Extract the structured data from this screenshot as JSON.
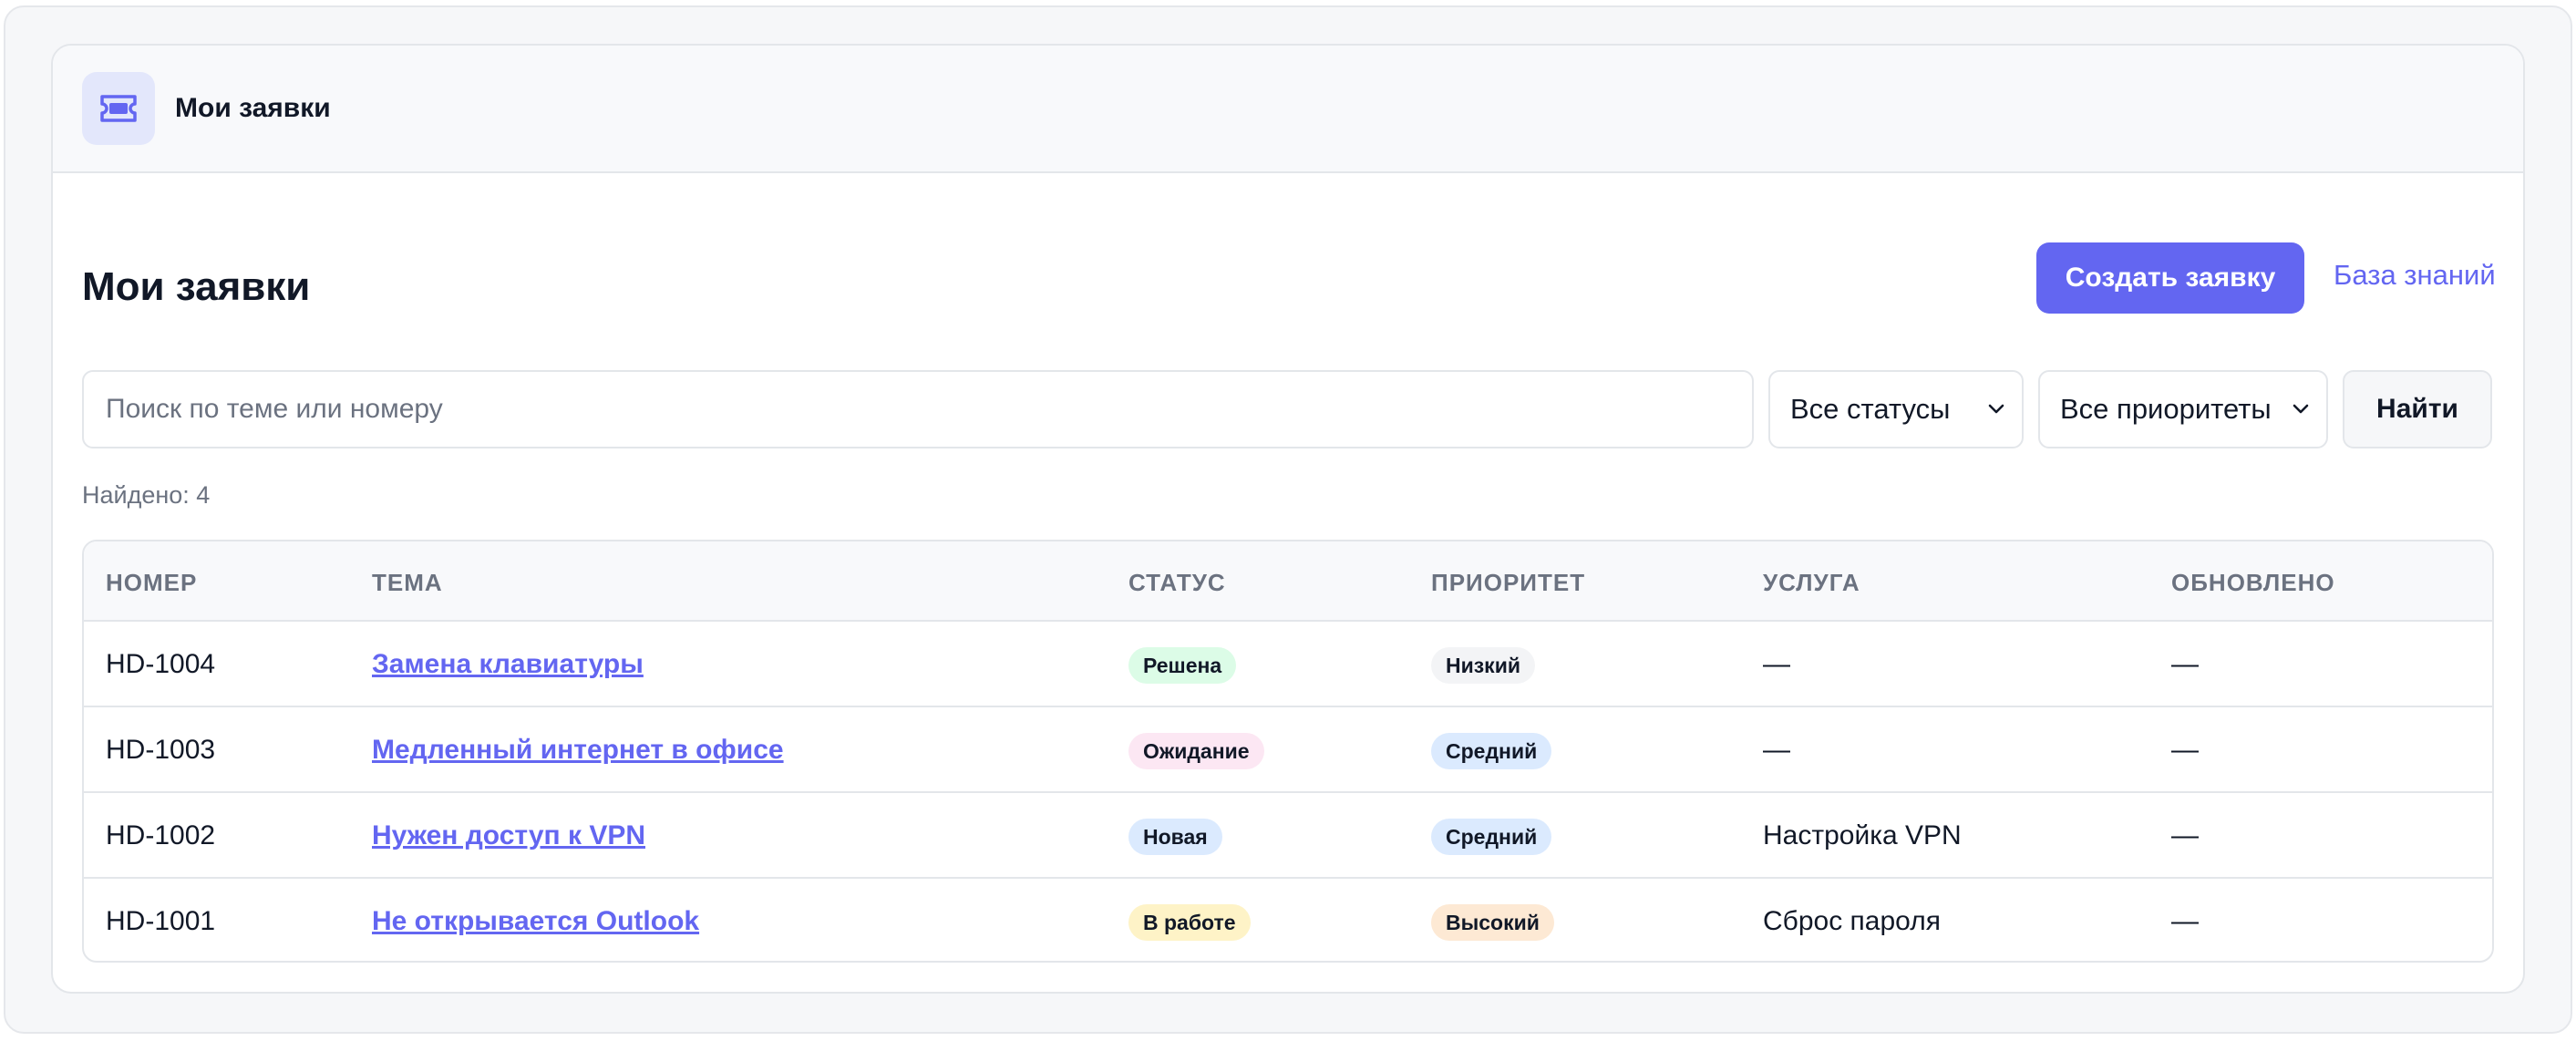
{
  "header": {
    "title": "Мои заявки",
    "icon": "ticket-icon",
    "accent": "#6366f1"
  },
  "main": {
    "title": "Мои заявки",
    "create_button": "Создать заявку",
    "kb_link": "База знаний"
  },
  "filters": {
    "search_placeholder": "Поиск по теме или номеру",
    "search_value": "",
    "status_selected": "Все статусы",
    "priority_selected": "Все приоритеты",
    "find_button": "Найти",
    "found_text": "Найдено: 4"
  },
  "table": {
    "columns": [
      "НОМЕР",
      "ТЕМА",
      "СТАТУС",
      "ПРИОРИТЕТ",
      "УСЛУГА",
      "ОБНОВЛЕНО"
    ],
    "rows": [
      {
        "number": "HD-1004",
        "topic": "Замена клавиатуры",
        "status": "Решена",
        "priority": "Низкий",
        "service": "—",
        "updated": "—"
      },
      {
        "number": "HD-1003",
        "topic": "Медленный интернет в офисе",
        "status": "Ожидание",
        "priority": "Средний",
        "service": "—",
        "updated": "—"
      },
      {
        "number": "HD-1002",
        "topic": "Нужен доступ к VPN",
        "status": "Новая",
        "priority": "Средний",
        "service": "Настройка VPN",
        "updated": "—"
      },
      {
        "number": "HD-1001",
        "topic": "Не открывается Outlook",
        "status": "В работе",
        "priority": "Высокий",
        "service": "Сброс пароля",
        "updated": "—"
      }
    ]
  },
  "colors": {
    "status": {
      "Решена": "#dcfce7",
      "Ожидание": "#fce7f3",
      "Новая": "#dbeafe",
      "В работе": "#fef3c7"
    },
    "priority": {
      "Низкий": "#f3f4f6",
      "Средний": "#dbeafe",
      "Высокий": "#fde9d4"
    }
  }
}
